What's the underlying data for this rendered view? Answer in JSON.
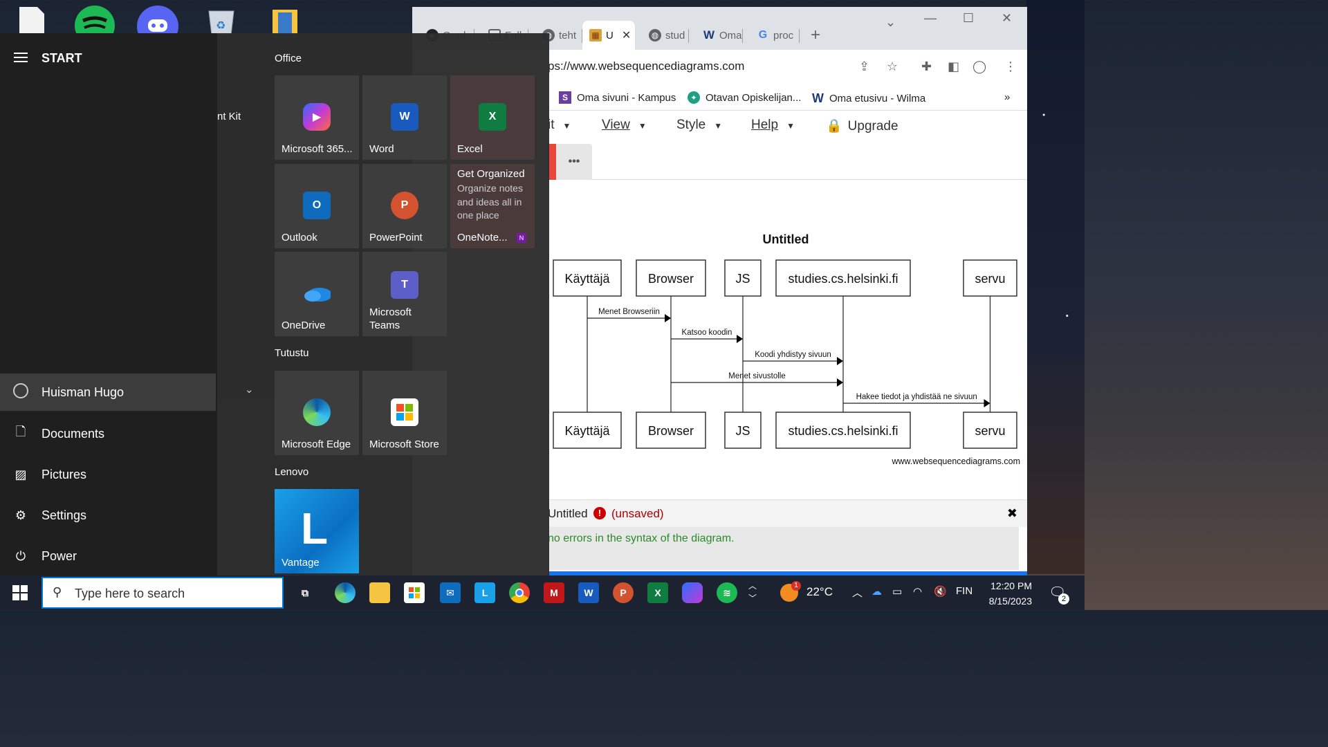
{
  "browser": {
    "tabs": [
      {
        "label": "Grad",
        "icon": "github-icon"
      },
      {
        "label": "Fulls",
        "icon": "page-icon"
      },
      {
        "label": "teht",
        "icon": "globe-icon"
      },
      {
        "label": "U",
        "icon": "websequence-icon"
      },
      {
        "label": "stud",
        "icon": "globe-icon"
      },
      {
        "label": "Oma",
        "icon": "wilma-icon"
      },
      {
        "label": "proc",
        "icon": "google-icon"
      }
    ],
    "new_tab": "+",
    "url": "ps://www.websequencediagrams.com",
    "bookmarks": [
      {
        "label": "Oma sivuni - Kampus",
        "icon": "S"
      },
      {
        "label": "Otavan Opiskelijan...",
        "icon": "star"
      },
      {
        "label": "Oma etusivu - Wilma",
        "icon": "W"
      }
    ],
    "bookmarks_more": "»",
    "menu": [
      {
        "label": "it"
      },
      {
        "label": "View"
      },
      {
        "label": "Style"
      },
      {
        "label": "Help"
      },
      {
        "label": "Upgrade"
      }
    ],
    "more_button": "•••",
    "diagram": {
      "title": "Untitled",
      "participants": [
        "Käyttäjä",
        "Browser",
        "JS",
        "studies.cs.helsinki.fi",
        "servu"
      ],
      "messages": [
        {
          "from": 0,
          "to": 1,
          "text": "Menet Browseriin"
        },
        {
          "from": 1,
          "to": 2,
          "text": "Katsoo koodin"
        },
        {
          "from": 2,
          "to": 3,
          "text": "Koodi yhdistyy sivuun"
        },
        {
          "from": 1,
          "to": 3,
          "text": "Menet sivustolle"
        },
        {
          "from": 3,
          "to": 4,
          "text": "Hakee tiedot ja yhdistää ne sivuun"
        }
      ],
      "watermark": "www.websequencediagrams.com"
    },
    "status": {
      "name": "Untitled",
      "unsaved": "(unsaved)",
      "close": "✖"
    },
    "message": "no errors in the syntax of the diagram."
  },
  "start": {
    "title": "START",
    "nav": [
      {
        "label": "Huisman Hugo",
        "icon": "user-icon"
      },
      {
        "label": "Documents",
        "icon": "document-icon"
      },
      {
        "label": "Pictures",
        "icon": "pictures-icon"
      },
      {
        "label": "Settings",
        "icon": "settings-icon"
      },
      {
        "label": "Power",
        "icon": "power-icon"
      }
    ],
    "partial_label": "nt Kit",
    "groups": {
      "office": "Office",
      "tutustu": "Tutustu",
      "lenovo": "Lenovo"
    },
    "tiles": {
      "m365": "Microsoft 365...",
      "word": "Word",
      "excel": "Excel",
      "outlook": "Outlook",
      "powerpoint": "PowerPoint",
      "onenote": "OneNote...",
      "onenote_title": "Get Organized",
      "onenote_desc": "Organize notes and ideas all in one place",
      "onedrive": "OneDrive",
      "teams_line1": "Microsoft",
      "teams_line2": "Teams",
      "edge": "Microsoft Edge",
      "store": "Microsoft Store",
      "vantage": "Vantage"
    }
  },
  "taskbar": {
    "search_placeholder": "Type here to search",
    "weather": "22°C",
    "weather_badge": "1",
    "lang": "FIN",
    "time": "12:20 PM",
    "date": "8/15/2023",
    "notif_count": "2"
  }
}
